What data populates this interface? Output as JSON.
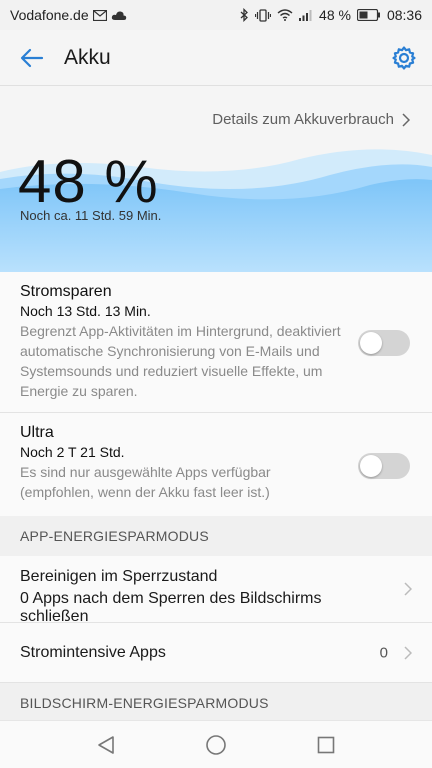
{
  "status_bar": {
    "carrier": "Vodafone.de",
    "battery_text": "48 %",
    "time": "08:36",
    "icons": [
      "mail-icon",
      "cloud-icon",
      "bluetooth-icon",
      "vibrate-icon",
      "wifi-icon",
      "signal-icon",
      "battery-icon"
    ]
  },
  "app_bar": {
    "title": "Akku",
    "back_icon": "back-arrow-icon",
    "settings_icon": "gear-icon"
  },
  "hero": {
    "details_link": "Details zum Akkuverbrauch",
    "percent": "48 %",
    "remaining": "Noch ca. 11 Std. 59 Min.",
    "accent": "#2a7fd4"
  },
  "power_saving": {
    "title": "Stromsparen",
    "subtitle": "Noch 13 Std. 13 Min.",
    "description": "Begrenzt App-Aktivitäten im Hintergrund, deaktiviert automatische Synchronisierung von E-Mails und Systemsounds und reduziert visuelle Effekte, um Energie zu sparen.",
    "enabled": false
  },
  "ultra": {
    "title": "Ultra",
    "subtitle": "Noch 2 T 21 Std.",
    "description": "Es sind nur ausgewählte Apps verfügbar (empfohlen, wenn der Akku fast leer ist.)",
    "enabled": false
  },
  "app_section": {
    "header": "APP-ENERGIESPARMODUS",
    "clean_title": "Bereinigen im Sperrzustand",
    "clean_subtitle": "0 Apps nach dem Sperren des Bildschirms schließen",
    "intensive_title": "Stromintensive Apps",
    "intensive_count": "0"
  },
  "screen_section": {
    "header": "BILDSCHIRM-ENERGIESPARMODUS"
  }
}
